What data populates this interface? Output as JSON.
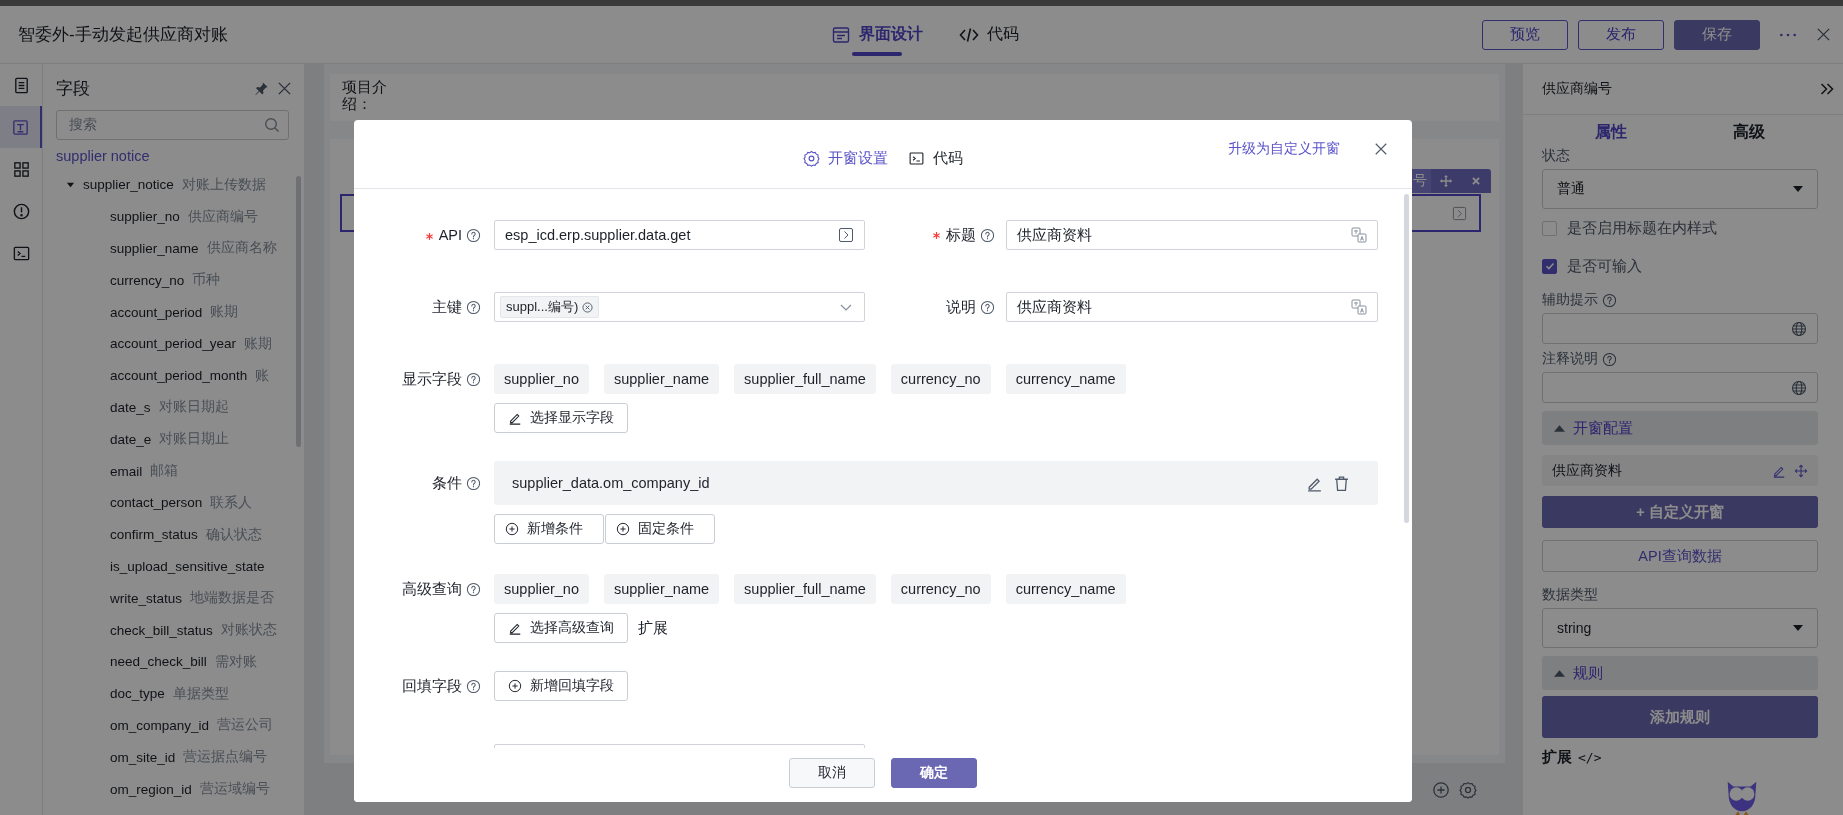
{
  "app": {
    "title": "智委外-手动发起供应商对账",
    "tabs": [
      {
        "label": "界面设计",
        "kind": "design",
        "selected": true
      },
      {
        "label": "代码",
        "kind": "code",
        "selected": false
      }
    ],
    "actions": [
      {
        "label": "预览",
        "kind": "outline"
      },
      {
        "label": "发布",
        "kind": "outline"
      },
      {
        "label": "保存",
        "kind": "primary"
      }
    ]
  },
  "rail": [
    {
      "kind": "outline",
      "selected": false
    },
    {
      "kind": "form",
      "selected": true
    },
    {
      "kind": "components",
      "selected": false
    },
    {
      "kind": "alert",
      "selected": false
    },
    {
      "kind": "console",
      "selected": false
    }
  ],
  "fields_panel": {
    "title": "字段",
    "search": {
      "placeholder": "搜索"
    },
    "source": "supplier notice",
    "tree": [
      {
        "name": "supplier_notice",
        "label": "对账上传数据",
        "expanded": true,
        "children": [
          {
            "name": "supplier_no",
            "label": "供应商编号"
          },
          {
            "name": "supplier_name",
            "label": "供应商名称"
          },
          {
            "name": "currency_no",
            "label": "币种"
          },
          {
            "name": "account_period",
            "label": "账期"
          },
          {
            "name": "account_period_year",
            "label": "账期"
          },
          {
            "name": "account_period_month",
            "label": "账"
          },
          {
            "name": "date_s",
            "label": "对账日期起"
          },
          {
            "name": "date_e",
            "label": "对账日期止"
          },
          {
            "name": "email",
            "label": "邮箱"
          },
          {
            "name": "contact_person",
            "label": "联系人"
          },
          {
            "name": "confirm_status",
            "label": "确认状态"
          },
          {
            "name": "is_upload_sensitive_state"
          },
          {
            "name": "write_status",
            "label": "地端数据是否"
          },
          {
            "name": "check_bill_status",
            "label": "对账状态"
          },
          {
            "name": "need_check_bill",
            "label": "需对账"
          },
          {
            "name": "doc_type",
            "label": "单据类型"
          },
          {
            "name": "om_company_id",
            "label": "营运公司"
          },
          {
            "name": "om_site_id",
            "label": "营运据点编号"
          },
          {
            "name": "om_region_id",
            "label": "营运域编号"
          }
        ]
      }
    ]
  },
  "canvas": {
    "intro": "项目介绍：",
    "toolbar_label": "号"
  },
  "properties": {
    "title": "供应商编号",
    "tabs": [
      {
        "label": "属性",
        "selected": true
      },
      {
        "label": "高级",
        "selected": false
      }
    ],
    "status": {
      "label": "状态",
      "value": "普通"
    },
    "checkboxes": [
      {
        "label": "是否启用标题在内样式",
        "checked": false
      },
      {
        "label": "是否可输入",
        "checked": true
      }
    ],
    "hint": {
      "label": "辅助提示"
    },
    "note": {
      "label": "注释说明"
    },
    "popup_section": {
      "label": "开窗配置",
      "expanded": true,
      "items": [
        "供应商资料"
      ],
      "buttons": [
        {
          "label": "+ 自定义开窗",
          "kind": "primary"
        },
        {
          "label": "API查询数据",
          "kind": "outline"
        }
      ]
    },
    "data_type": {
      "label": "数据类型",
      "value": "string"
    },
    "rules_section": {
      "label": "规则",
      "expanded": true,
      "buttons": [
        {
          "label": "添加规则",
          "kind": "primary"
        }
      ]
    },
    "extension": {
      "label": "扩展",
      "code": "</>"
    }
  },
  "modal": {
    "tabs": [
      {
        "label": "开窗设置",
        "kind": "settings",
        "selected": true
      },
      {
        "label": "代码",
        "kind": "console",
        "selected": false
      }
    ],
    "upgrade_link": "升级为自定义开窗",
    "api": {
      "label": "API",
      "required": true,
      "value": "esp_icd.erp.supplier.data.get"
    },
    "title_field": {
      "label": "标题",
      "required": true,
      "value": "供应商资料"
    },
    "primary_key": {
      "label": "主键",
      "required": false,
      "tags": [
        "suppl...编号)"
      ]
    },
    "description": {
      "label": "说明",
      "required": false,
      "value": "供应商资料"
    },
    "display_fields": {
      "label": "显示字段",
      "tags": [
        "supplier_no",
        "supplier_name",
        "supplier_full_name",
        "currency_no",
        "currency_name"
      ],
      "button": "选择显示字段"
    },
    "conditions": {
      "label": "条件",
      "items": [
        "supplier_data.om_company_id"
      ],
      "buttons": [
        "新增条件",
        "固定条件"
      ]
    },
    "advanced_query": {
      "label": "高级查询",
      "tags": [
        "supplier_no",
        "supplier_name",
        "supplier_full_name",
        "currency_no",
        "currency_name"
      ],
      "button": "选择高级查询",
      "extra": "扩展"
    },
    "backfill": {
      "label": "回填字段",
      "button": "新增回填字段"
    },
    "buttons": [
      {
        "label": "取消",
        "kind": "default"
      },
      {
        "label": "确定",
        "kind": "primary"
      }
    ]
  }
}
